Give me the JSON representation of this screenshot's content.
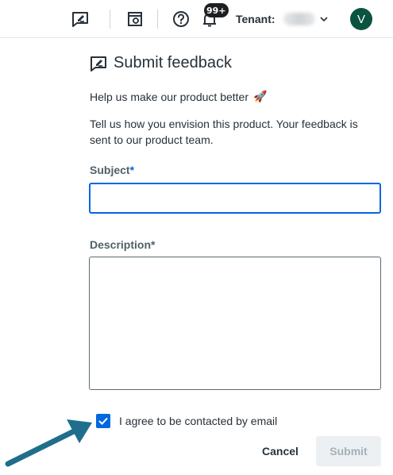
{
  "header": {
    "notification_count": "99+",
    "tenant_label": "Tenant:",
    "tenant_value": "",
    "avatar_initial": "V",
    "icons": [
      "feedback-icon",
      "admin-icon",
      "help-icon",
      "notification-icon",
      "chevron-down-icon"
    ]
  },
  "panel": {
    "title": "Submit feedback",
    "intro": "Help us make our product better",
    "intro_emoji": "🚀",
    "description": "Tell us how you envision this product. Your feedback is sent to our product team.",
    "subject_label": "Subject",
    "description_label": "Description",
    "required_marker": "*",
    "subject_value": "",
    "description_value": "",
    "agree_label": "I agree to be contacted by email",
    "agree_checked": true,
    "cancel_label": "Cancel",
    "submit_label": "Submit"
  },
  "colors": {
    "accent": "#0067df",
    "avatar_bg": "#0b5341",
    "annotation_arrow": "#1f6e8c",
    "disabled_text": "#a4b1b8"
  }
}
